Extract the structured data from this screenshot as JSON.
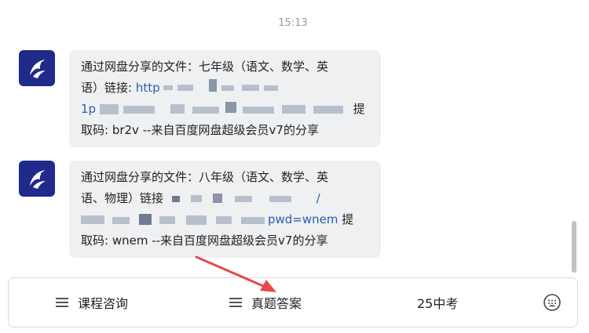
{
  "chat": {
    "timestamp": "15:13",
    "messages": [
      {
        "line1": "通过网盘分享的文件：七年级（语文、数学、英",
        "line2_prefix": "语）链接: ",
        "link_start": "http",
        "link_line2_start": "1p",
        "line3_tail": " 提",
        "line4": "取码: br2v --来自百度网盘超级会员v7的分享"
      },
      {
        "line1": "通过网盘分享的文件：八年级（语文、数学、英",
        "line2_prefix": "语、物理）链接",
        "link_end_char": "/",
        "link_tail": "pwd=wnem",
        "line3_tail": " 提",
        "line4": "取码: wnem --来自百度网盘超级会员v7的分享"
      }
    ]
  },
  "bottom_menu": {
    "items": [
      {
        "label": "课程咨询",
        "icon": "menu-icon"
      },
      {
        "label": "真题答案",
        "icon": "menu-icon"
      },
      {
        "label": "25中考"
      }
    ],
    "keyboard_icon": "keyboard-icon"
  },
  "colors": {
    "avatar_bg": "#1f2a8a",
    "bubble_bg": "#eef0f2",
    "link": "#2a5ea8",
    "arrow": "#e8484a"
  }
}
